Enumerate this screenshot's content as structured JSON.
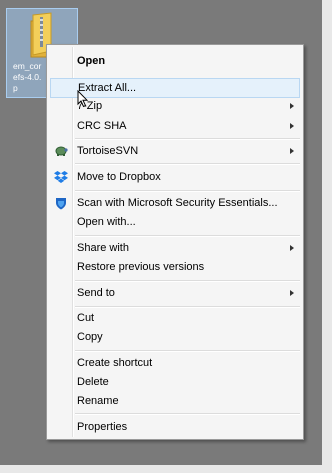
{
  "desktop": {
    "file": {
      "name": "em_cor\nefs-4.0.\np",
      "icon": "zip-folder-icon"
    }
  },
  "menu": {
    "open": "Open",
    "extract_all": "Extract All...",
    "seven_zip": "7-Zip",
    "crc_sha": "CRC SHA",
    "tortoisesvn": "TortoiseSVN",
    "move_to_dropbox": "Move to Dropbox",
    "scan_mse": "Scan with Microsoft Security Essentials...",
    "open_with": "Open with...",
    "share_with": "Share with",
    "restore_previous_versions": "Restore previous versions",
    "send_to": "Send to",
    "cut": "Cut",
    "copy": "Copy",
    "create_shortcut": "Create shortcut",
    "delete": "Delete",
    "rename": "Rename",
    "properties": "Properties"
  },
  "colors": {
    "menu_bg": "#f5f5f5",
    "hover_bg": "#e5f1fb",
    "desktop_bg": "#7a7a7a",
    "selection": "#a0c8f0"
  }
}
